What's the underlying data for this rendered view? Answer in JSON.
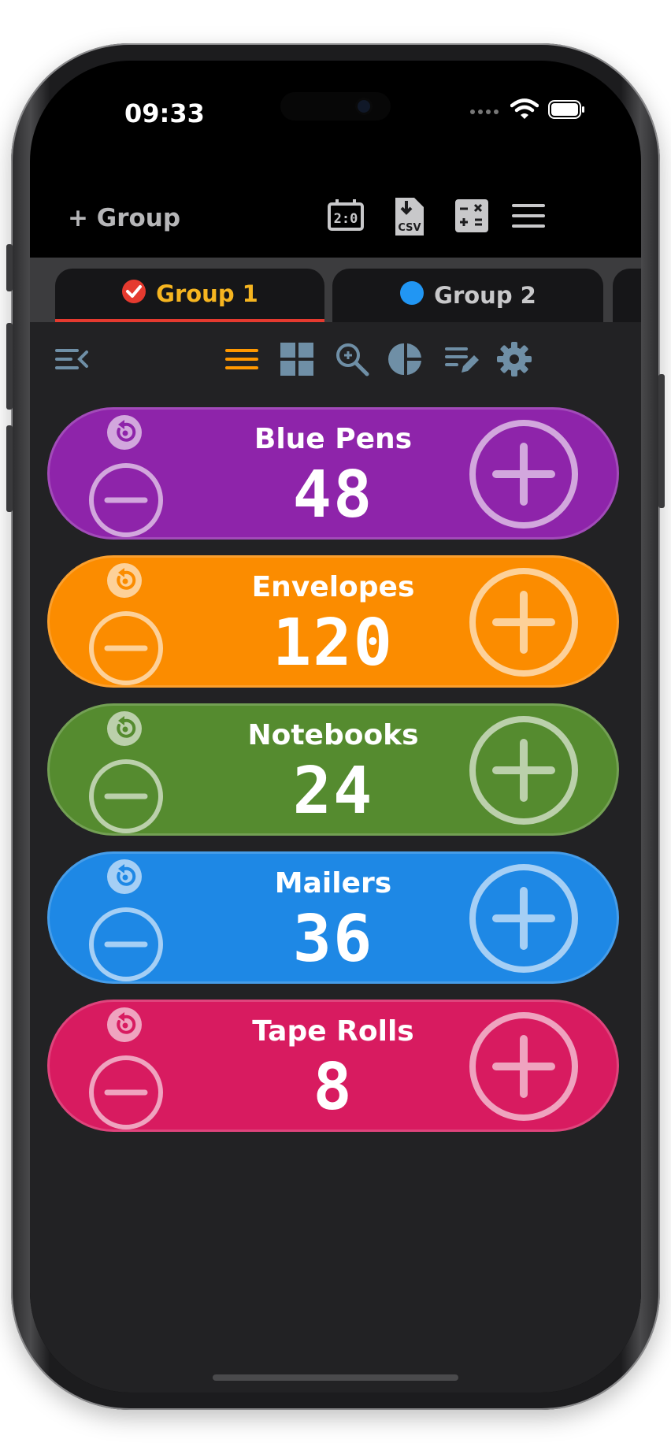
{
  "status_bar": {
    "time": "09:33"
  },
  "app_bar": {
    "add_group_label": "+ Group",
    "icons": [
      "scoreboard-icon",
      "csv-export-icon",
      "calculator-icon",
      "menu-icon"
    ]
  },
  "tabs": [
    {
      "label": "Group 1",
      "icon": "red-check-circle",
      "selected": true
    },
    {
      "label": "Group 2",
      "icon": "blue-dot",
      "selected": false
    }
  ],
  "toolbar": {
    "icons": [
      "collapse-menu-icon",
      "list-view-icon",
      "grid-view-icon",
      "search-icon",
      "pie-chart-icon",
      "edit-list-icon",
      "settings-icon"
    ]
  },
  "counters": [
    {
      "name": "Blue Pens",
      "count": "48",
      "color": "#8e24aa"
    },
    {
      "name": "Envelopes",
      "count": "120",
      "color": "#fb8c00"
    },
    {
      "name": "Notebooks",
      "count": "24",
      "color": "#558b2f"
    },
    {
      "name": "Mailers",
      "count": "36",
      "color": "#1e88e5"
    },
    {
      "name": "Tape Rolls",
      "count": "8",
      "color": "#d81b60"
    }
  ],
  "colors": {
    "selected_tab_text": "#f6b520",
    "selected_tab_underline": "#e53a2f",
    "toolbar_active": "#ff9800",
    "toolbar_icon": "#6f8fa6"
  }
}
